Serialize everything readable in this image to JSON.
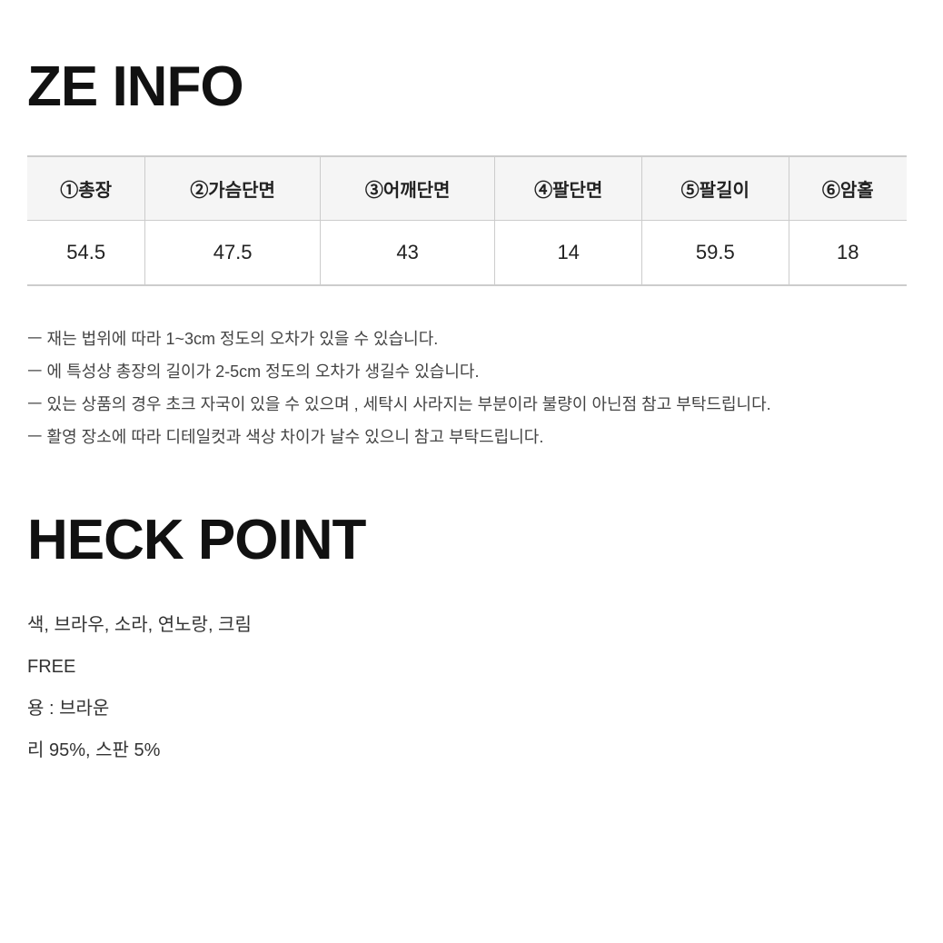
{
  "size_info": {
    "title": "ZE INFO",
    "table": {
      "headers": [
        "①총장",
        "②가슴단면",
        "③어깨단면",
        "④팔단면",
        "⑤팔길이",
        "⑥암홀"
      ],
      "rows": [
        [
          "54.5",
          "47.5",
          "43",
          "14",
          "59.5",
          "18"
        ]
      ]
    },
    "notes": [
      "ㅡ 재는 법위에 따라 1~3cm 정도의 오차가 있을 수 있습니다.",
      "ㅡ 에 특성상 총장의 길이가 2-5cm 정도의 오차가 생길수 있습니다.",
      "ㅡ 있는 상품의 경우 초크 자국이 있을 수 있으며 , 세탁시 사라지는 부분이라 불량이 아닌점 참고 부탁드립니다.",
      "ㅡ 활영 장소에 따라 디테일컷과 색상 차이가 날수 있으니 참고 부탁드립니다."
    ]
  },
  "check_point": {
    "title": "HECK POINT",
    "items": [
      "색, 브라우, 소라, 연노랑, 크림",
      "FREE",
      "용 : 브라운",
      "리 95%, 스판 5%"
    ]
  }
}
